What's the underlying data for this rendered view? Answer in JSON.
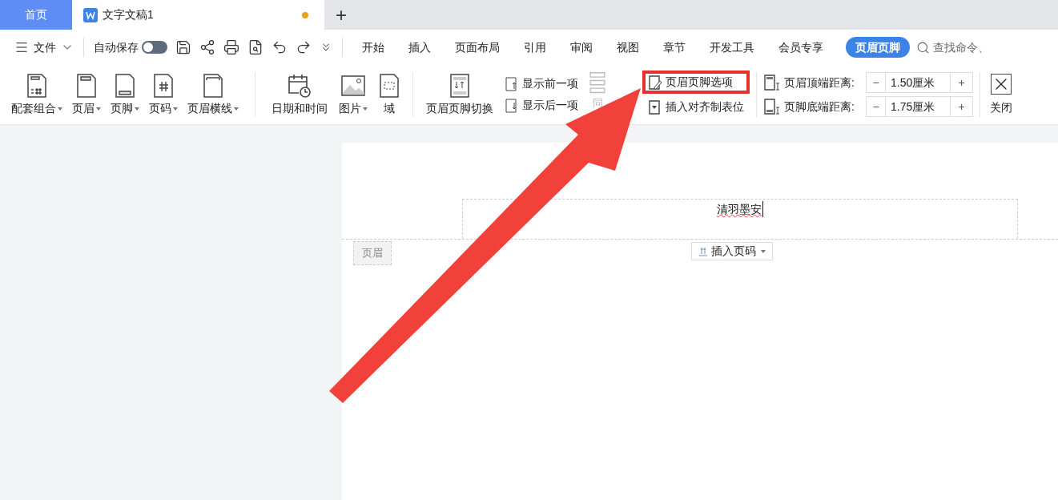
{
  "tabs": [
    {
      "label": "首页",
      "kind": "home",
      "selected": false
    },
    {
      "label": "文字文稿1",
      "kind": "document",
      "selected": true,
      "unsaved": true
    }
  ],
  "new_tab": "+",
  "menu_bar": {
    "file": "文件",
    "autosave": {
      "label": "自动保存",
      "on": false
    },
    "tabs": [
      {
        "label": "开始",
        "selected": false
      },
      {
        "label": "插入",
        "selected": false
      },
      {
        "label": "页面布局",
        "selected": false
      },
      {
        "label": "引用",
        "selected": false
      },
      {
        "label": "审阅",
        "selected": false
      },
      {
        "label": "视图",
        "selected": false
      },
      {
        "label": "章节",
        "selected": false
      },
      {
        "label": "开发工具",
        "selected": false
      },
      {
        "label": "会员专享",
        "selected": false
      },
      {
        "label": "页眉页脚",
        "selected": true
      }
    ],
    "search": {
      "placeholder": "查找命令、"
    }
  },
  "ribbon": {
    "insert_group": [
      {
        "label": "配套组合",
        "dropdown": true
      },
      {
        "label": "页眉",
        "dropdown": true
      },
      {
        "label": "页脚",
        "dropdown": true
      },
      {
        "label": "页码",
        "dropdown": true
      },
      {
        "label": "页眉横线",
        "dropdown": true
      }
    ],
    "field_group": [
      {
        "label": "日期和时间",
        "dropdown": false
      },
      {
        "label": "图片",
        "dropdown": true
      },
      {
        "label": "域",
        "dropdown": false
      }
    ],
    "switch": {
      "label": "页眉页脚切换"
    },
    "navigation": [
      {
        "label": "显示前一项"
      },
      {
        "label": "显示后一项"
      }
    ],
    "same_as_previous": {
      "label": "同",
      "disabled": true
    },
    "options": [
      {
        "label": "页眉页脚选项",
        "highlighted": true
      },
      {
        "label": "插入对齐制表位",
        "highlighted": false
      }
    ],
    "distances": [
      {
        "label": "页眉顶端距离:",
        "minus": "−",
        "value": "1.50厘米",
        "plus": "+"
      },
      {
        "label": "页脚底端距离:",
        "minus": "−",
        "value": "1.75厘米",
        "plus": "+"
      }
    ],
    "close": {
      "label": "关闭"
    }
  },
  "document": {
    "header_text": "清羽墨安",
    "header_tag": "页眉",
    "insert_page_number": "插入页码"
  }
}
